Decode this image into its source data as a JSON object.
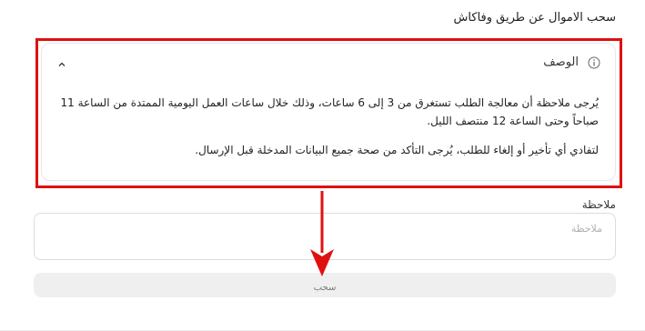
{
  "page": {
    "title": "سحب الاموال عن طريق وفاكاش"
  },
  "description": {
    "title": "الوصف",
    "paragraph1": "يُرجى ملاحظة أن معالجة الطلب تستغرق من 3 إلى 6 ساعات، وذلك خلال ساعات العمل اليومية الممتدة من الساعة 11 صباحاً وحتى الساعة 12 منتصف الليل.",
    "paragraph2": "لتفادي أي تأخير أو إلغاء للطلب، يُرجى التأكد من صحة جميع البيانات المدخلة قبل الإرسال.",
    "expanded": true
  },
  "note": {
    "label": "ملاحظة",
    "placeholder": "ملاحظة",
    "value": ""
  },
  "submit": {
    "label": "سحب"
  },
  "colors": {
    "annotation": "#e01010",
    "button_bg": "#efefef",
    "border": "#dcdcdc"
  },
  "icons": {
    "info": "info-icon",
    "collapse": "chevron-up-icon",
    "annotation_arrow": "arrow-down-icon"
  }
}
